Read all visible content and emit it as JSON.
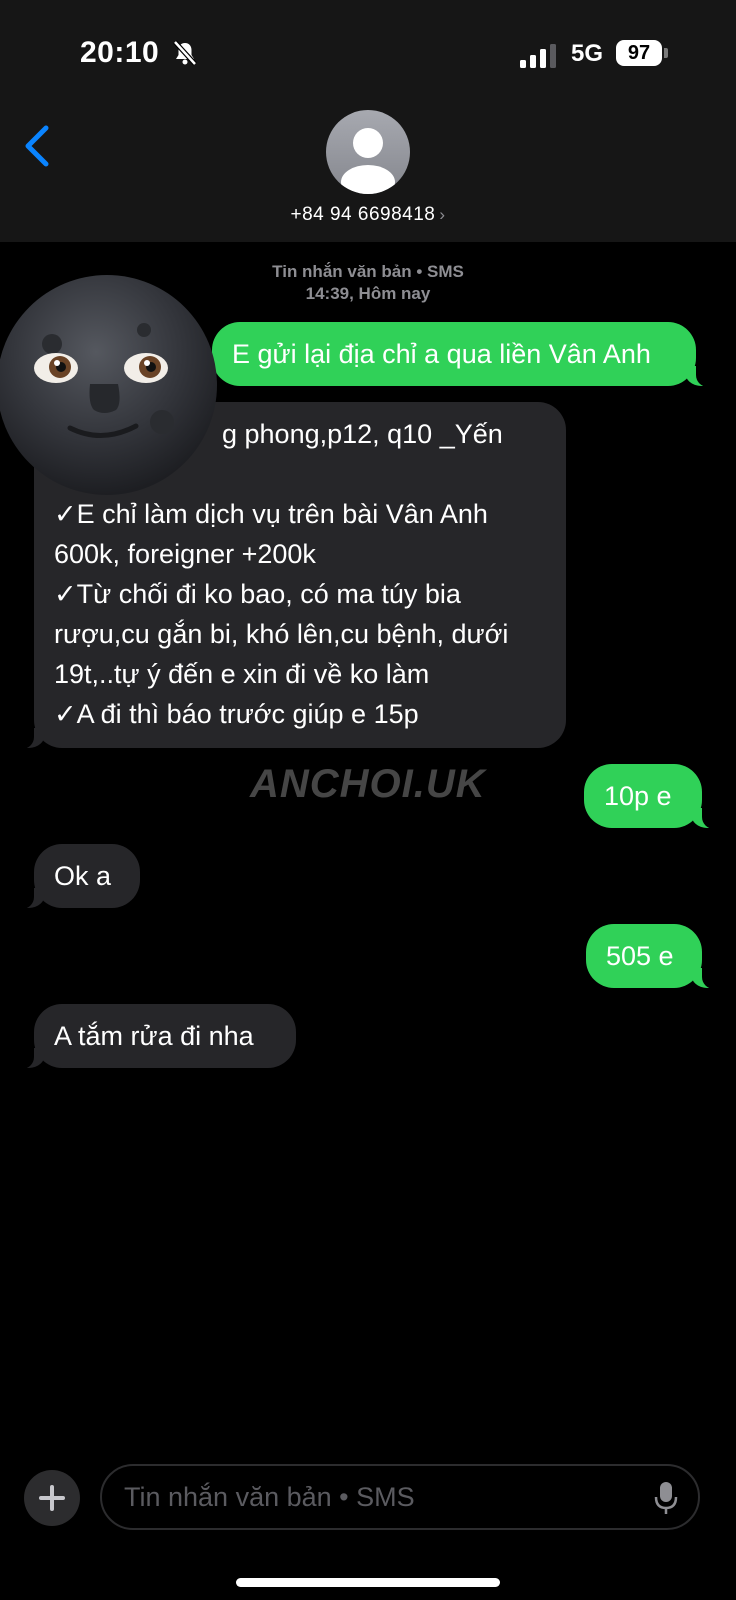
{
  "status_bar": {
    "time": "20:10",
    "network": "5G",
    "battery": "97"
  },
  "header": {
    "contact": "+84 94 6698418"
  },
  "thread": {
    "label": "Tin nhắn văn bản • SMS",
    "timestamp": "14:39, Hôm nay"
  },
  "messages": [
    {
      "from": "me",
      "lines": [
        "E gửi lại địa chỉ a qua liền Vân Anh"
      ]
    },
    {
      "from": "them",
      "lines": [
        "g phong,p12, q10 _Yến",
        "",
        "✓E chỉ làm dịch vụ trên bài Vân Anh",
        "600k, foreigner +200k",
        "✓Từ chối đi ko bao, có ma túy bia",
        "rượu,cu gắn bi, khó lên,cu bệnh, dưới",
        "19t,..tự ý đến e xin đi về ko làm",
        "✓A đi thì báo trước giúp e 15p"
      ]
    },
    {
      "from": "me",
      "lines": [
        "10p e"
      ]
    },
    {
      "from": "them",
      "lines": [
        "Ok a"
      ]
    },
    {
      "from": "me",
      "lines": [
        "505 e"
      ]
    },
    {
      "from": "them",
      "lines": [
        "A tắm rửa đi nha"
      ]
    }
  ],
  "watermark": "ANCHOI.UK",
  "composer": {
    "placeholder": "Tin nhắn văn bản • SMS"
  },
  "icons": [
    "bell-slash-icon",
    "signal-icon",
    "back-chevron-icon",
    "person-icon",
    "chevron-right-icon",
    "plus-icon",
    "mic-icon",
    "moon-face-emoji"
  ],
  "colors": {
    "outgoing": "#30d158",
    "incoming": "#262629",
    "accent": "#0a84ff"
  }
}
